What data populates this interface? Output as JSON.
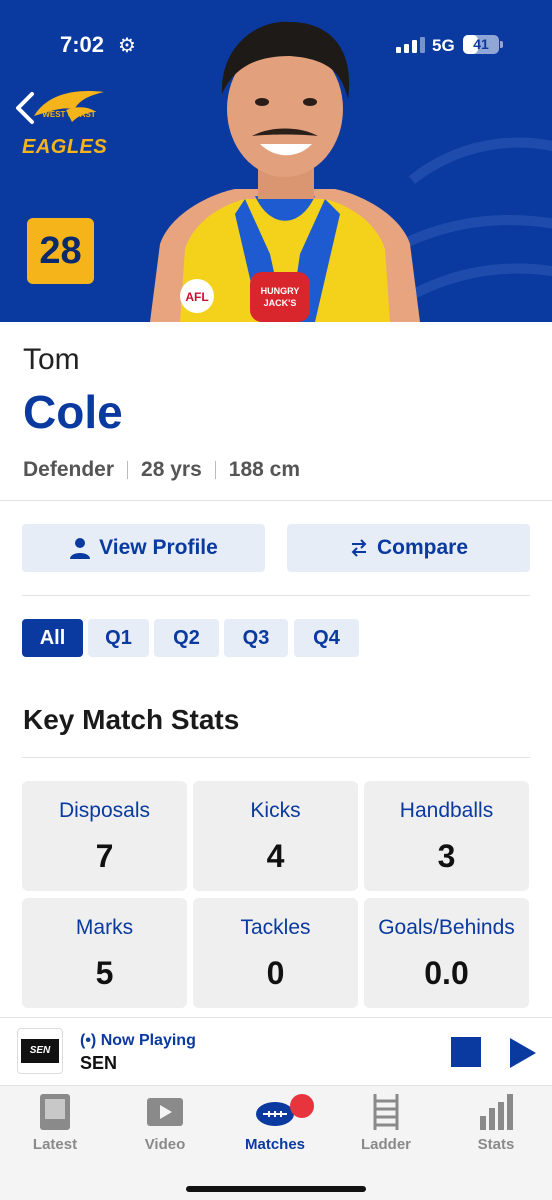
{
  "status_bar": {
    "time": "7:02",
    "network": "5G",
    "battery": "41",
    "battery_level": 0.41
  },
  "team": {
    "logo_top": "WEST COAST",
    "logo_bottom": "EAGLES"
  },
  "player": {
    "number": "28",
    "first_name": "Tom",
    "last_name": "Cole",
    "position": "Defender",
    "age": "28 yrs",
    "height": "188 cm"
  },
  "actions": {
    "view_profile": "View Profile",
    "compare": "Compare"
  },
  "quarter_tabs": [
    "All",
    "Q1",
    "Q2",
    "Q3",
    "Q4"
  ],
  "selected_quarter": "All",
  "section_title": "Key Match Stats",
  "stats": [
    {
      "label": "Disposals",
      "value": "7"
    },
    {
      "label": "Kicks",
      "value": "4"
    },
    {
      "label": "Handballs",
      "value": "3"
    },
    {
      "label": "Marks",
      "value": "5"
    },
    {
      "label": "Tackles",
      "value": "0"
    },
    {
      "label": "Goals/Behinds",
      "value": "0.0"
    }
  ],
  "now_playing": {
    "logo_text": "SEN",
    "status": "Now Playing",
    "station": "SEN"
  },
  "tabbar": {
    "items": [
      {
        "label": "Latest",
        "icon": "latest-icon"
      },
      {
        "label": "Video",
        "icon": "video-icon"
      },
      {
        "label": "Matches",
        "icon": "football-icon"
      },
      {
        "label": "Ladder",
        "icon": "ladder-icon"
      },
      {
        "label": "Stats",
        "icon": "stats-icon"
      }
    ],
    "active": "Matches"
  },
  "colors": {
    "primary": "#0a3aa0",
    "gold": "#f4b41a",
    "badge": "#e8343d"
  }
}
